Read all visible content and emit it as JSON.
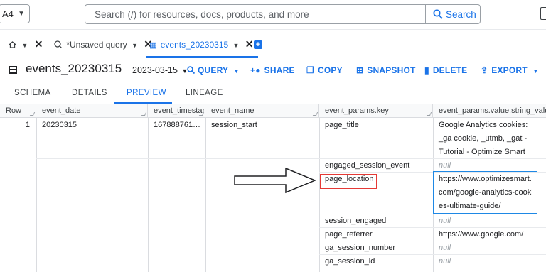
{
  "topbar": {
    "project": "A4",
    "search_placeholder": "Search (/) for resources, docs, products, and more",
    "search_button": "Search"
  },
  "tabs": {
    "query_tab": "*Unsaved query",
    "table_tab": "events_20230315"
  },
  "titlebar": {
    "title": "events_20230315",
    "date": "2023-03-15",
    "actions": {
      "query": "QUERY",
      "share": "SHARE",
      "copy": "COPY",
      "snapshot": "SNAPSHOT",
      "delete": "DELETE",
      "export": "EXPORT"
    }
  },
  "subtabs": [
    "SCHEMA",
    "DETAILS",
    "PREVIEW",
    "LINEAGE"
  ],
  "columns": [
    "Row",
    "event_date",
    "event_timestamp",
    "event_name",
    "event_params.key",
    "event_params.value.string_value"
  ],
  "row": {
    "row_num": "1",
    "event_date": "20230315",
    "event_timestamp": "167888761…",
    "event_name": "session_start"
  },
  "params": [
    {
      "key": "page_title",
      "value": "Google Analytics cookies: _ga cookie, _utmb, _gat - Tutorial - Optimize Smart"
    },
    {
      "key": "engaged_session_event",
      "value": "null"
    },
    {
      "key": "page_location",
      "value": "https://www.optimizesmart.com/google-analytics-cookies-ultimate-guide/"
    },
    {
      "key": "session_engaged",
      "value": "null"
    },
    {
      "key": "page_referrer",
      "value": "https://www.google.com/"
    },
    {
      "key": "ga_session_number",
      "value": "null"
    },
    {
      "key": "ga_session_id",
      "value": "null"
    }
  ],
  "colors": {
    "accent": "#1a73e8",
    "highlight_red": "#e53935",
    "highlight_blue": "#1e88e5"
  }
}
